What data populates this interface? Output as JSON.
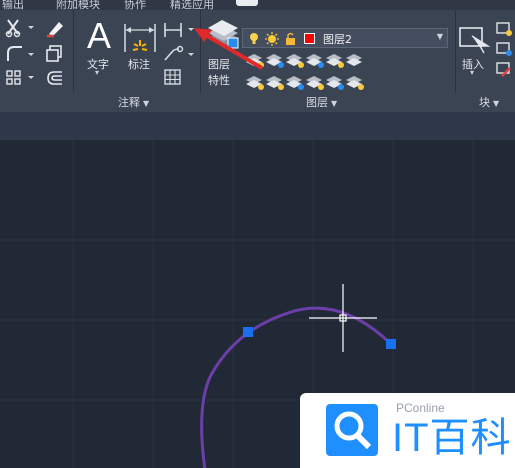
{
  "menubar": {
    "items": [
      "输出",
      "附加模块",
      "协作",
      "精选应用"
    ]
  },
  "annotation_panel": {
    "title": "注释",
    "text_label": "文字",
    "dimension_label": "标注"
  },
  "layers_panel": {
    "title": "图层",
    "layer_properties_label": [
      "图层",
      "特性"
    ],
    "current_layer": {
      "name": "图层2",
      "color": "#ff0000"
    }
  },
  "block_panel": {
    "title": "块",
    "insert_label": "插入"
  },
  "watermark": {
    "brand": "PConline",
    "logo_text": "IT百科",
    "color": "#1f8fff"
  },
  "colors": {
    "arc": "#6c3fa8",
    "grip": "#1a6ff0",
    "arrow": "#e02a2a"
  }
}
